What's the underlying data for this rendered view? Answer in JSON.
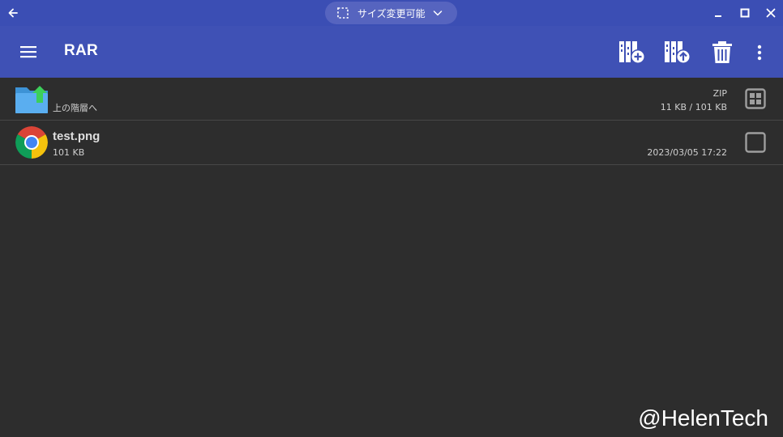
{
  "titlebar": {
    "back_icon": "arrow-left-icon",
    "resize_label": "サイズ変更可能",
    "resize_icon": "dashed-square-icon",
    "dropdown_icon": "chevron-down-icon",
    "minimize_icon": "minimize-icon",
    "maximize_icon": "maximize-icon",
    "close_icon": "close-icon"
  },
  "appbar": {
    "title": "RAR",
    "menu_icon": "hamburger-menu-icon",
    "actions": [
      {
        "name": "archive-add-icon"
      },
      {
        "name": "archive-extract-icon"
      },
      {
        "name": "trash-icon"
      },
      {
        "name": "more-vert-icon"
      }
    ]
  },
  "files": [
    {
      "kind": "parent",
      "icon": "folder-up-icon",
      "name": "",
      "subtitle": "上の階層へ",
      "format": "ZIP",
      "size": "11 KB / 101 KB",
      "check_icon": "grid-select-all-icon"
    },
    {
      "kind": "file",
      "icon": "chrome-icon",
      "name": "test.png",
      "subtitle": "101 KB",
      "date": "2023/03/05 17:22",
      "check_icon": "checkbox-empty-icon"
    }
  ],
  "watermark": "@HelenTech",
  "colors": {
    "titlebar": "#3b4eb4",
    "appbar": "#3f51b5",
    "background": "#2d2d2d",
    "divider": "#474747"
  }
}
